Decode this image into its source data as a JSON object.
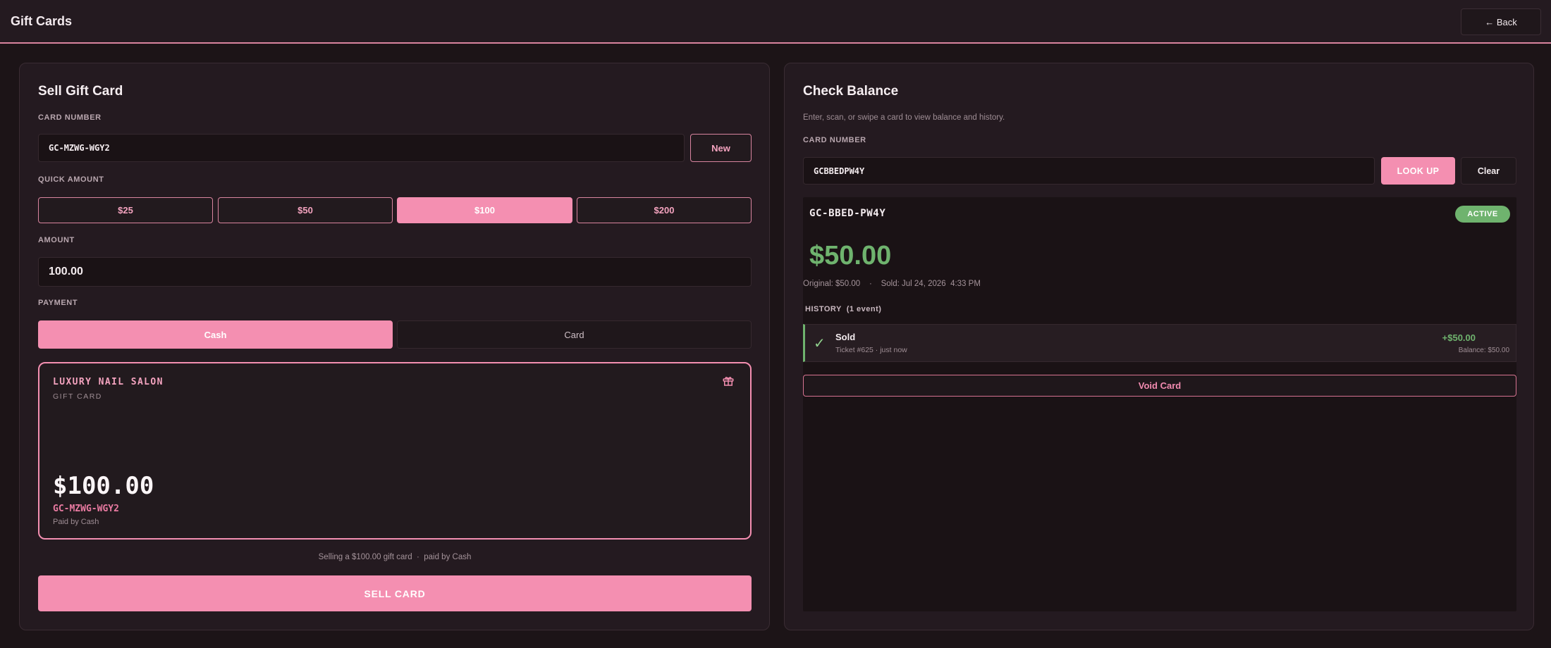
{
  "header": {
    "title": "Gift Cards",
    "back_label": "← Back"
  },
  "sell": {
    "title": "Sell Gift Card",
    "card_number_label": "CARD NUMBER",
    "card_number_value": "GC-MZWG-WGY2",
    "new_label": "New",
    "quick_amount_label": "QUICK AMOUNT",
    "quick_amounts": [
      "$25",
      "$50",
      "$100",
      "$200"
    ],
    "selected_quick_amount": "$100",
    "amount_label": "AMOUNT",
    "amount_value": "100.00",
    "payment_label": "PAYMENT",
    "payment_options": [
      "Cash",
      "Card"
    ],
    "selected_payment": "Cash",
    "preview": {
      "salon_name": "LUXURY NAIL SALON",
      "card_type": "GIFT CARD",
      "amount": "$100.00",
      "number": "GC-MZWG-WGY2",
      "paid_by": "Paid by Cash"
    },
    "summary_text": "Selling a $100.00 gift card  ·  paid by Cash",
    "sell_button": "SELL CARD"
  },
  "balance": {
    "title": "Check Balance",
    "subtitle": "Enter, scan, or swipe a card to view balance and history.",
    "card_number_label": "CARD NUMBER",
    "card_number_value": "GCBBEDPW4Y",
    "lookup_label": "LOOK UP",
    "clear_label": "Clear",
    "result": {
      "card_number": "GC-BBED-PW4Y",
      "status": "ACTIVE",
      "balance": "$50.00",
      "original": "Original: $50.00",
      "separator": "·",
      "sold": "Sold: Jul 24, 2026  4:33 PM",
      "history_label": "HISTORY",
      "history_count": "(1 event)",
      "history": [
        {
          "icon": "check-icon",
          "title": "Sold",
          "detail": "Ticket #625 · just now",
          "amount": "+$50.00",
          "balance_after": "Balance: $50.00"
        }
      ],
      "void_label": "Void Card"
    }
  },
  "colors": {
    "accent": "#f48fb1",
    "success": "#6fb36e",
    "background": "#1c1417",
    "panel": "#241a20"
  }
}
